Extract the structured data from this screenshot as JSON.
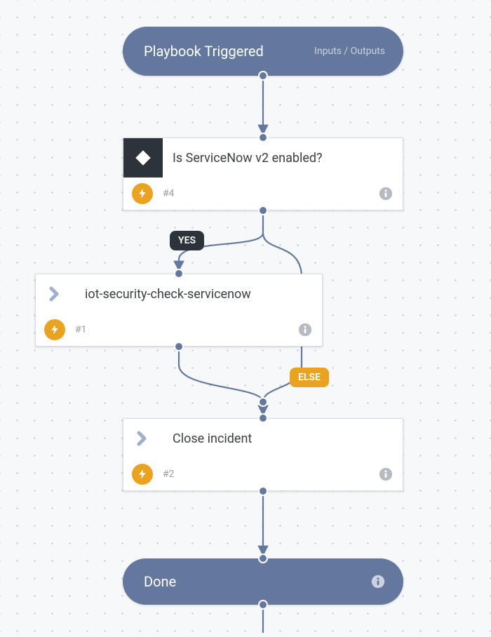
{
  "start": {
    "title": "Playbook Triggered",
    "io_link": "Inputs / Outputs"
  },
  "tasks": {
    "condition": {
      "title": "Is ServiceNow v2 enabled?",
      "num": "#4"
    },
    "t1": {
      "title": "iot-security-check-servicenow",
      "num": "#1"
    },
    "t2": {
      "title": "Close incident",
      "num": "#2"
    }
  },
  "labels": {
    "yes": "YES",
    "else": "ELSE"
  },
  "end": {
    "title": "Done"
  },
  "colors": {
    "capsule": "#63789c",
    "accent": "#eaa221",
    "edge": "#63789c"
  }
}
